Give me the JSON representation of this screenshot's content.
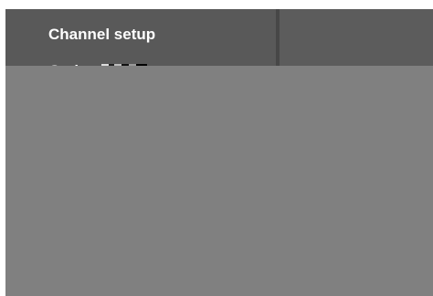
{
  "menu": {
    "items": [
      {
        "label": "Channel setup"
      },
      {
        "label": "Go ba"
      }
    ]
  },
  "colors": {
    "screen": "#808080",
    "menu_panel": "#595959",
    "right_panel": "#5c5c5c",
    "divider": "#474747",
    "text": "#ffffff"
  }
}
